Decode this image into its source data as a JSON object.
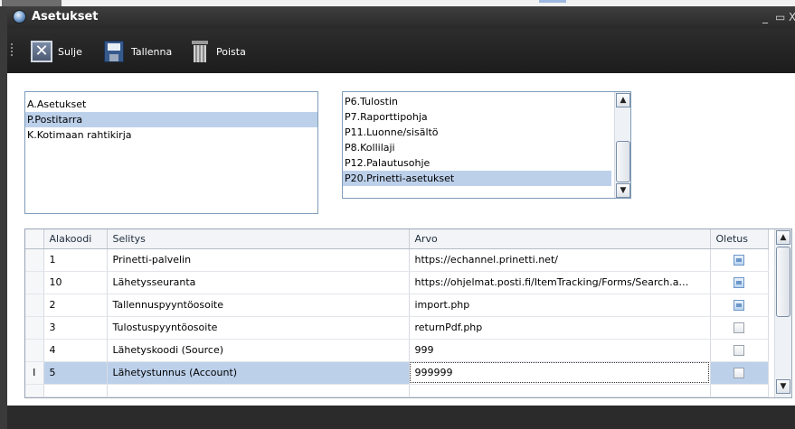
{
  "window": {
    "title": "Asetukset",
    "minimize_glyph": "_",
    "restore_glyph": "▭",
    "close_glyph": "X"
  },
  "toolbar": {
    "close_label": "Sulje",
    "save_label": "Tallenna",
    "delete_label": "Poista",
    "close_icon_glyph": "✕"
  },
  "categories": {
    "items": [
      {
        "label": "A.Asetukset",
        "selected": false
      },
      {
        "label": "P.Postitarra",
        "selected": true
      },
      {
        "label": "K.Kotimaan rahtikirja",
        "selected": false
      }
    ]
  },
  "subcategories": {
    "items": [
      {
        "label": "P6.Tulostin",
        "selected": false
      },
      {
        "label": "P7.Raporttipohja",
        "selected": false
      },
      {
        "label": "P11.Luonne/sisältö",
        "selected": false
      },
      {
        "label": "P8.Kollilaji",
        "selected": false
      },
      {
        "label": "P12.Palautusohje",
        "selected": false
      },
      {
        "label": "P20.Prinetti-asetukset",
        "selected": true
      }
    ]
  },
  "grid": {
    "columns": {
      "code": "Alakoodi",
      "desc": "Selitys",
      "value": "Arvo",
      "default": "Oletus"
    },
    "current_row_marker": "I",
    "rows": [
      {
        "code": "1",
        "desc": "Prinetti-palvelin",
        "value": "https://echannel.prinetti.net/",
        "default": true
      },
      {
        "code": "10",
        "desc": "Lähetysseuranta",
        "value": "https://ohjelmat.posti.fi/ItemTracking/Forms/Search.a…",
        "default": true
      },
      {
        "code": "2",
        "desc": "Tallennuspyyntöosoite",
        "value": "import.php",
        "default": true
      },
      {
        "code": "3",
        "desc": "Tulostuspyyntöosoite",
        "value": "returnPdf.php",
        "default": false
      },
      {
        "code": "4",
        "desc": "Lähetyskoodi (Source)",
        "value": "999",
        "default": false
      },
      {
        "code": "5",
        "desc": "Lähetystunnus (Account)",
        "value": "999999",
        "default": false
      }
    ]
  },
  "scroll": {
    "up_glyph": "▲",
    "down_glyph": "▼"
  },
  "colors": {
    "selection": "#bcd0ea",
    "chrome_dark": "#2b2b2b",
    "border_blue": "#7f9db9"
  }
}
